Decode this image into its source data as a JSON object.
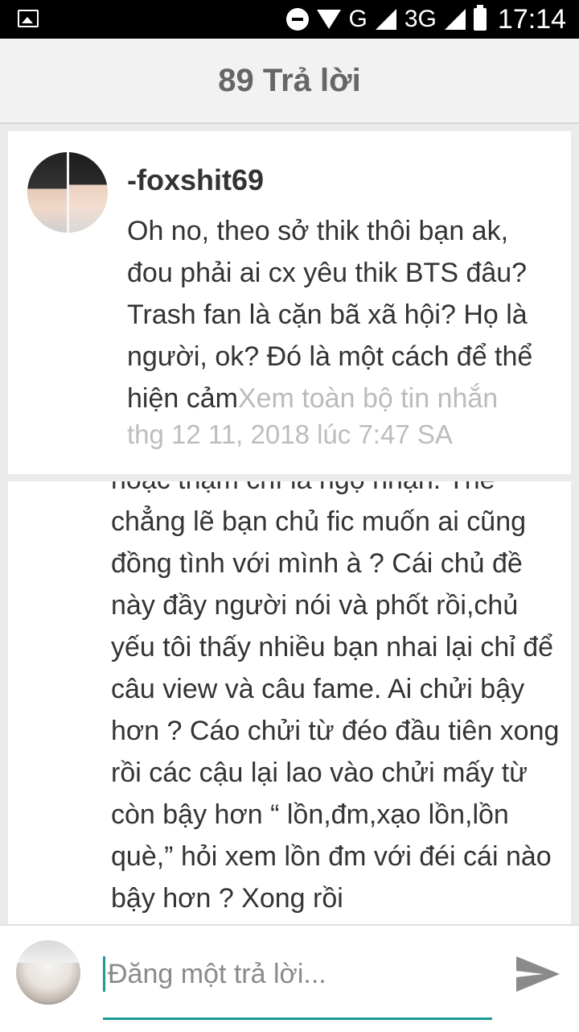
{
  "status_bar": {
    "network_type": "G",
    "network_type_2": "3G",
    "time": "17:14"
  },
  "header": {
    "title": "89 Trả lời"
  },
  "comment": {
    "username": "-foxshit69",
    "message": "Oh no, theo sở thik thôi bạn ak, đou phải ai cx yêu thik BTS đâu? Trash fan là cặn bã xã hội? Họ là người, ok? Đó là một cách để thể hiện cảm",
    "read_more": "Xem toàn bộ tin nhắn",
    "timestamp": "thg 12 11, 2018 lúc 7:47 SA"
  },
  "thread": {
    "text": "hoặc thậm chí là ngộ nhận. Thế chẳng lẽ bạn chủ fic muốn ai cũng đồng tình với mình à ? Cái chủ đề này đầy người nói và phốt rồi,chủ yếu tôi thấy nhiều bạn nhai lại chỉ để câu view và câu fame. Ai chửi bậy hơn ? Cáo chửi từ đéo đầu tiên xong rồi các cậu lại lao vào chửi mấy từ còn bậy hơn “ lồn,đm,xạo lồn,lồn què,” hỏi xem lồn đm với đéi cái nào bậy hơn ? Xong rồi"
  },
  "composer": {
    "placeholder": "Đăng một trả lời..."
  },
  "icons": {
    "gallery": "image-icon",
    "dnd": "do-not-disturb-icon",
    "wifi": "wifi-icon",
    "signal": "cell-signal-icon",
    "battery": "battery-icon",
    "send": "send-icon"
  },
  "colors": {
    "accent": "#1a9c94",
    "header_bg": "#f2f2f2",
    "page_bg": "#ebebeb"
  }
}
